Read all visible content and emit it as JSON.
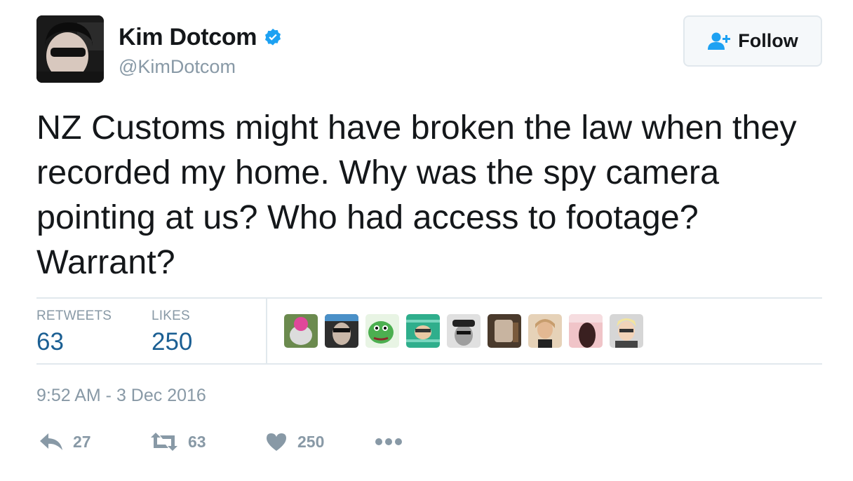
{
  "author": {
    "name": "Kim Dotcom",
    "handle": "@KimDotcom",
    "verified": true,
    "avatar_icon": "user-avatar"
  },
  "follow_button": {
    "label": "Follow",
    "icon": "follow-user-icon"
  },
  "tweet": {
    "text": "NZ Customs might have broken the law when they recorded my home. Why was the spy camera pointing at us? Who had access to footage? Warrant?",
    "timestamp": "9:52 AM - 3 Dec 2016"
  },
  "stats": {
    "retweets_label": "RETWEETS",
    "retweets_value": "63",
    "likes_label": "LIKES",
    "likes_value": "250"
  },
  "likers": [
    {
      "name": "liker-avatar-1",
      "color": "#6b8a4e"
    },
    {
      "name": "liker-avatar-2",
      "color": "#3a3a3a"
    },
    {
      "name": "liker-avatar-3",
      "color": "#4caf50"
    },
    {
      "name": "liker-avatar-4",
      "color": "#2fae8c"
    },
    {
      "name": "liker-avatar-5",
      "color": "#888888"
    },
    {
      "name": "liker-avatar-6",
      "color": "#7a5a3c"
    },
    {
      "name": "liker-avatar-7",
      "color": "#c79d6d"
    },
    {
      "name": "liker-avatar-8",
      "color": "#d9a4a8"
    },
    {
      "name": "liker-avatar-9",
      "color": "#444444"
    }
  ],
  "actions": {
    "reply_count": "27",
    "retweet_count": "63",
    "like_count": "250"
  },
  "colors": {
    "text": "#14171a",
    "muted": "#8899a6",
    "stat_value": "#1b5f93",
    "verified": "#1da1f2",
    "border": "#e1e8ed"
  }
}
